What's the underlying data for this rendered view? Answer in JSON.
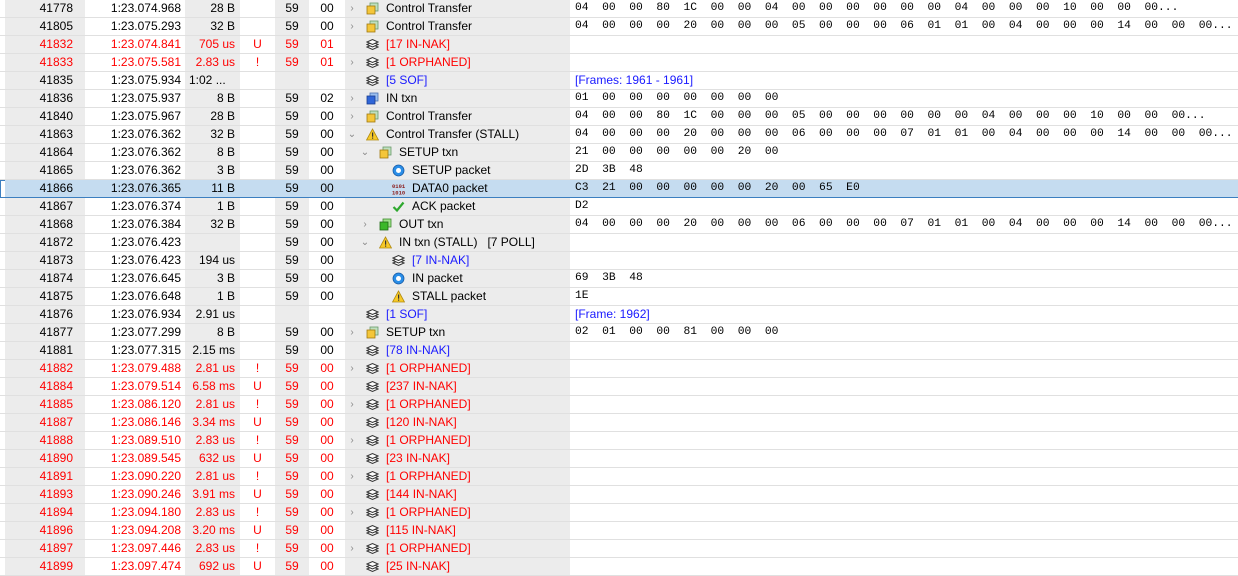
{
  "colors": {
    "error_red": "#ff0000",
    "link_blue": "#1a1aff",
    "selected_bg": "#c5dcf0",
    "selected_border": "#3c7fc0"
  },
  "rows": [
    {
      "num": "41778",
      "time": "1:23.074.968",
      "len": "28 B",
      "flag": "",
      "dev": "59",
      "ep": "00",
      "level": 0,
      "expander": "collapsed",
      "icon": "gold-cube-icon",
      "label": "Control Transfer",
      "data": "04 00 00 80 1C 00 00 04 00 00 00 00 00 00 04 00 00 00 10 00 00 00..."
    },
    {
      "num": "41805",
      "time": "1:23.075.293",
      "len": "32 B",
      "flag": "",
      "dev": "59",
      "ep": "00",
      "level": 0,
      "expander": "collapsed",
      "icon": "gold-cube-icon",
      "label": "Control Transfer",
      "data": "04 00 00 00 20 00 00 00 05 00 00 00 06 01 01 00 04 00 00 00 14 00 00 00..."
    },
    {
      "num": "41832",
      "time": "1:23.074.841",
      "len": "705 us",
      "flag": "U",
      "dev": "59",
      "ep": "01",
      "level": 0,
      "expander": "none",
      "icon": "stack-icon",
      "label": "[17 IN-NAK]",
      "label_color": "red",
      "row_color": "red",
      "data": ""
    },
    {
      "num": "41833",
      "time": "1:23.075.581",
      "len": "2.83 us",
      "flag": "!",
      "dev": "59",
      "ep": "01",
      "level": 0,
      "expander": "collapsed",
      "icon": "stack-icon",
      "label": "[1 ORPHANED]",
      "label_color": "red",
      "row_color": "red",
      "data": ""
    },
    {
      "num": "41835",
      "time": "1:23.075.934",
      "len": "1:02 ...",
      "flag": "",
      "dev": "",
      "ep": "",
      "level": 0,
      "expander": "none",
      "icon": "stack-icon",
      "label": "[5 SOF]",
      "label_color": "blue",
      "data": "[Frames: 1961 - 1961]",
      "data_color": "blue"
    },
    {
      "num": "41836",
      "time": "1:23.075.937",
      "len": "8 B",
      "flag": "",
      "dev": "59",
      "ep": "02",
      "level": 0,
      "expander": "collapsed",
      "icon": "blue-cube-icon",
      "label": "IN txn",
      "data": "01 00 00 00 00 00 00 00"
    },
    {
      "num": "41840",
      "time": "1:23.075.967",
      "len": "28 B",
      "flag": "",
      "dev": "59",
      "ep": "00",
      "level": 0,
      "expander": "collapsed",
      "icon": "gold-cube-icon",
      "label": "Control Transfer",
      "data": "04 00 00 80 1C 00 00 00 05 00 00 00 00 00 00 04 00 00 00 10 00 00 00..."
    },
    {
      "num": "41863",
      "time": "1:23.076.362",
      "len": "32 B",
      "flag": "",
      "dev": "59",
      "ep": "00",
      "level": 0,
      "expander": "expanded",
      "icon": "warning-icon",
      "label": "Control Transfer (STALL)",
      "data": "04 00 00 00 20 00 00 00 06 00 00 00 07 01 01 00 04 00 00 00 14 00 00 00..."
    },
    {
      "num": "41864",
      "time": "1:23.076.362",
      "len": "8 B",
      "flag": "",
      "dev": "59",
      "ep": "00",
      "level": 1,
      "expander": "expanded",
      "icon": "gold-cube-icon",
      "label": "SETUP txn",
      "data": "21 00 00 00 00 00 20 00"
    },
    {
      "num": "41865",
      "time": "1:23.076.362",
      "len": "3 B",
      "flag": "",
      "dev": "59",
      "ep": "00",
      "level": 2,
      "expander": "none",
      "icon": "packet-circle-icon",
      "label": "SETUP packet",
      "data": "2D 3B 48"
    },
    {
      "num": "41866",
      "time": "1:23.076.365",
      "len": "11 B",
      "flag": "",
      "dev": "59",
      "ep": "00",
      "level": 2,
      "expander": "none",
      "icon": "binary-data-icon",
      "label": "DATA0 packet",
      "selected": true,
      "data": "C3 21 00 00 00 00 00 20 00 65 E0"
    },
    {
      "num": "41867",
      "time": "1:23.076.374",
      "len": "1 B",
      "flag": "",
      "dev": "59",
      "ep": "00",
      "level": 2,
      "expander": "none",
      "icon": "check-icon",
      "label": "ACK packet",
      "data": "D2"
    },
    {
      "num": "41868",
      "time": "1:23.076.384",
      "len": "32 B",
      "flag": "",
      "dev": "59",
      "ep": "00",
      "level": 1,
      "expander": "collapsed",
      "icon": "green-cube-icon",
      "label": "OUT txn",
      "data": "04 00 00 00 20 00 00 00 06 00 00 00 07 01 01 00 04 00 00 00 14 00 00 00..."
    },
    {
      "num": "41872",
      "time": "1:23.076.423",
      "len": "",
      "flag": "",
      "dev": "59",
      "ep": "00",
      "level": 1,
      "expander": "expanded",
      "icon": "warning-icon",
      "label": "IN txn (STALL)   [7 POLL]",
      "data": ""
    },
    {
      "num": "41873",
      "time": "1:23.076.423",
      "len": "194 us",
      "flag": "",
      "dev": "59",
      "ep": "00",
      "level": 2,
      "expander": "none",
      "icon": "stack-icon",
      "label": "[7 IN-NAK]",
      "label_color": "blue",
      "data": ""
    },
    {
      "num": "41874",
      "time": "1:23.076.645",
      "len": "3 B",
      "flag": "",
      "dev": "59",
      "ep": "00",
      "level": 2,
      "expander": "none",
      "icon": "packet-circle-icon",
      "label": "IN packet",
      "data": "69 3B 48"
    },
    {
      "num": "41875",
      "time": "1:23.076.648",
      "len": "1 B",
      "flag": "",
      "dev": "59",
      "ep": "00",
      "level": 2,
      "expander": "none",
      "icon": "warning-icon",
      "label": "STALL packet",
      "data": "1E"
    },
    {
      "num": "41876",
      "time": "1:23.076.934",
      "len": "2.91 us",
      "flag": "",
      "dev": "",
      "ep": "",
      "level": 0,
      "expander": "none",
      "icon": "stack-icon",
      "label": "[1 SOF]",
      "label_color": "blue",
      "data": "[Frame: 1962]",
      "data_color": "blue"
    },
    {
      "num": "41877",
      "time": "1:23.077.299",
      "len": "8 B",
      "flag": "",
      "dev": "59",
      "ep": "00",
      "level": 0,
      "expander": "collapsed",
      "icon": "gold-cube-icon",
      "label": "SETUP txn",
      "data": "02 01 00 00 81 00 00 00"
    },
    {
      "num": "41881",
      "time": "1:23.077.315",
      "len": "2.15 ms",
      "flag": "",
      "dev": "59",
      "ep": "00",
      "level": 0,
      "expander": "none",
      "icon": "stack-icon",
      "label": "[78 IN-NAK]",
      "label_color": "blue",
      "data": ""
    },
    {
      "num": "41882",
      "time": "1:23.079.488",
      "len": "2.81 us",
      "flag": "!",
      "dev": "59",
      "ep": "00",
      "level": 0,
      "expander": "collapsed",
      "icon": "stack-icon",
      "label": "[1 ORPHANED]",
      "label_color": "red",
      "row_color": "red",
      "data": ""
    },
    {
      "num": "41884",
      "time": "1:23.079.514",
      "len": "6.58 ms",
      "flag": "U",
      "dev": "59",
      "ep": "00",
      "level": 0,
      "expander": "none",
      "icon": "stack-icon",
      "label": "[237 IN-NAK]",
      "label_color": "red",
      "row_color": "red",
      "data": ""
    },
    {
      "num": "41885",
      "time": "1:23.086.120",
      "len": "2.81 us",
      "flag": "!",
      "dev": "59",
      "ep": "00",
      "level": 0,
      "expander": "collapsed",
      "icon": "stack-icon",
      "label": "[1 ORPHANED]",
      "label_color": "red",
      "row_color": "red",
      "data": ""
    },
    {
      "num": "41887",
      "time": "1:23.086.146",
      "len": "3.34 ms",
      "flag": "U",
      "dev": "59",
      "ep": "00",
      "level": 0,
      "expander": "none",
      "icon": "stack-icon",
      "label": "[120 IN-NAK]",
      "label_color": "red",
      "row_color": "red",
      "data": ""
    },
    {
      "num": "41888",
      "time": "1:23.089.510",
      "len": "2.83 us",
      "flag": "!",
      "dev": "59",
      "ep": "00",
      "level": 0,
      "expander": "collapsed",
      "icon": "stack-icon",
      "label": "[1 ORPHANED]",
      "label_color": "red",
      "row_color": "red",
      "data": ""
    },
    {
      "num": "41890",
      "time": "1:23.089.545",
      "len": "632 us",
      "flag": "U",
      "dev": "59",
      "ep": "00",
      "level": 0,
      "expander": "none",
      "icon": "stack-icon",
      "label": "[23 IN-NAK]",
      "label_color": "red",
      "row_color": "red",
      "data": ""
    },
    {
      "num": "41891",
      "time": "1:23.090.220",
      "len": "2.81 us",
      "flag": "!",
      "dev": "59",
      "ep": "00",
      "level": 0,
      "expander": "collapsed",
      "icon": "stack-icon",
      "label": "[1 ORPHANED]",
      "label_color": "red",
      "row_color": "red",
      "data": ""
    },
    {
      "num": "41893",
      "time": "1:23.090.246",
      "len": "3.91 ms",
      "flag": "U",
      "dev": "59",
      "ep": "00",
      "level": 0,
      "expander": "none",
      "icon": "stack-icon",
      "label": "[144 IN-NAK]",
      "label_color": "red",
      "row_color": "red",
      "data": ""
    },
    {
      "num": "41894",
      "time": "1:23.094.180",
      "len": "2.83 us",
      "flag": "!",
      "dev": "59",
      "ep": "00",
      "level": 0,
      "expander": "collapsed",
      "icon": "stack-icon",
      "label": "[1 ORPHANED]",
      "label_color": "red",
      "row_color": "red",
      "data": ""
    },
    {
      "num": "41896",
      "time": "1:23.094.208",
      "len": "3.20 ms",
      "flag": "U",
      "dev": "59",
      "ep": "00",
      "level": 0,
      "expander": "none",
      "icon": "stack-icon",
      "label": "[115 IN-NAK]",
      "label_color": "red",
      "row_color": "red",
      "data": ""
    },
    {
      "num": "41897",
      "time": "1:23.097.446",
      "len": "2.83 us",
      "flag": "!",
      "dev": "59",
      "ep": "00",
      "level": 0,
      "expander": "collapsed",
      "icon": "stack-icon",
      "label": "[1 ORPHANED]",
      "label_color": "red",
      "row_color": "red",
      "data": ""
    },
    {
      "num": "41899",
      "time": "1:23.097.474",
      "len": "692 us",
      "flag": "U",
      "dev": "59",
      "ep": "00",
      "level": 0,
      "expander": "none",
      "icon": "stack-icon",
      "label": "[25 IN-NAK]",
      "label_color": "red",
      "row_color": "red",
      "data": ""
    }
  ]
}
